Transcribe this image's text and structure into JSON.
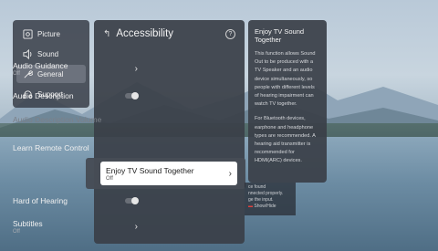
{
  "categories": [
    {
      "label": "Picture",
      "icon": "picture-icon",
      "active": false
    },
    {
      "label": "Sound",
      "icon": "speaker-icon",
      "active": false
    },
    {
      "label": "General",
      "icon": "wrench-icon",
      "active": true
    },
    {
      "label": "Support",
      "icon": "headset-icon",
      "active": false
    }
  ],
  "accessibility": {
    "back_glyph": "↰",
    "title": "Accessibility",
    "help_glyph": "?",
    "items": [
      {
        "label": "Audio Guidance",
        "sub": "Off"
      },
      {
        "label": "Audio Description"
      },
      {
        "label": "Audio Description Volume"
      },
      {
        "label": "Learn Remote Control"
      },
      {
        "label": "Enjoy TV Sound Together",
        "sub": "Off"
      },
      {
        "label": "Hard of Hearing"
      },
      {
        "label": "Subtitles",
        "sub": "Off"
      }
    ]
  },
  "info": {
    "title": "Enjoy TV Sound Together",
    "para1": "This function allows Sound Out to be produced with a TV Speaker and an audio device simultaneously, so people with different levels of hearing impairment can watch TV together.",
    "para2": "For Bluetooth devices, earphone and headphone types are recommended. A hearing aid transmitter is recommended for HDMI(ARC) devices."
  },
  "underlying_popup": {
    "line1": "ce found",
    "line2": "nnected properly.",
    "line3": "ge the input.",
    "show_hide_label": "Show/Hide",
    "show_hide_glyph": "▬"
  },
  "colors": {
    "panel_bg": "#3a3f48",
    "focus_bg": "#ffffff",
    "accent_red": "#e0413e"
  }
}
